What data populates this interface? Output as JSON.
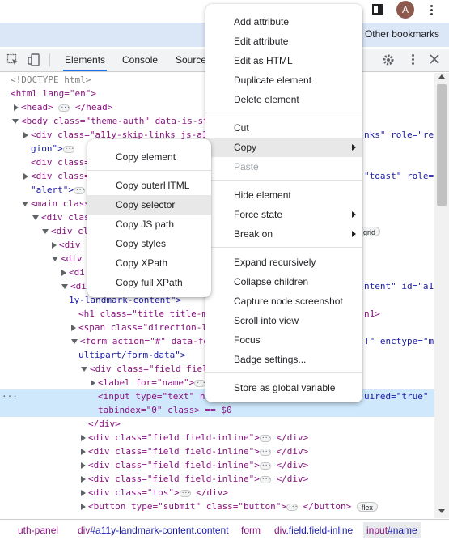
{
  "browser": {
    "bookmarks_label": "Other bookmarks",
    "avatar_letter": "A",
    "accent": "#dbe6f6"
  },
  "devtools": {
    "tabs": [
      "Elements",
      "Console",
      "Source"
    ],
    "active_tab": "Elements"
  },
  "dom_lines": [
    {
      "text": "<!DOCTYPE html>"
    },
    {
      "text": "<html lang=\"en\">"
    },
    {
      "text": "<head>"
    },
    {
      "text": "<body class=\"theme-auth\" data-is-st"
    },
    {
      "text": "<div class=\"a11y-skip-links js-a1"
    },
    {
      "text": "gion\">"
    },
    {
      "text": "<div class="
    },
    {
      "text": "<div class="
    },
    {
      "text": "\"alert\">"
    },
    {
      "text": "<main class"
    },
    {
      "text": "<div clas"
    },
    {
      "text": "<div cl"
    },
    {
      "text": "<div"
    },
    {
      "text": "<div"
    },
    {
      "text": "<di"
    },
    {
      "text": "<di"
    },
    {
      "text": "1y-landmark-content\">"
    },
    {
      "text": "<h1 class=\"title title-m"
    },
    {
      "text": "<span class=\"direction-l"
    },
    {
      "text": "<form action=\"#\" data-fo"
    },
    {
      "text": "ultipart/form-data\">"
    },
    {
      "text": "<div class=\"field fiel"
    },
    {
      "text": "<label for=\"name\">"
    },
    {
      "text": "<input type=\"text\" n"
    },
    {
      "text": "tabindex=\"0\" class> == $0"
    },
    {
      "text": "</div>"
    },
    {
      "text": "<div class=\"field field-inline\">"
    },
    {
      "text": "<div class=\"field field-inline\">"
    },
    {
      "text": "<div class=\"field field-inline\">"
    },
    {
      "text": "<div class=\"field field-inline\">"
    },
    {
      "text": "<div class=\"tos\">"
    },
    {
      "text": "<button type=\"submit\" class=\"button\">"
    }
  ],
  "dom_tails": {
    "l3": "</head>",
    "l4": "nks\" role=\"re",
    "l7": "\"toast\" role=",
    "l12": "grid",
    "l15": "ntent\" id=\"a1",
    "l17": "n1>",
    "l19": "T\" enctype=\"m",
    "l23": "uired=\"true\"",
    "closing_div": "</div>",
    "closing_button": "</button>",
    "flex_badge": "flex"
  },
  "breadcrumb": [
    {
      "t": "uth-panel",
      "c": ""
    },
    {
      "t": "div",
      "c": "#a11y-landmark-content.content"
    },
    {
      "t": "form",
      "c": ""
    },
    {
      "t": "div",
      "c": ".field.field-inline"
    },
    {
      "t": "input",
      "c": "#name"
    }
  ],
  "main_menu": {
    "items": [
      "Add attribute",
      "Edit attribute",
      "Edit as HTML",
      "Duplicate element",
      "Delete element",
      "Cut",
      "Copy",
      "Paste",
      "Hide element",
      "Force state",
      "Break on",
      "Expand recursively",
      "Collapse children",
      "Capture node screenshot",
      "Scroll into view",
      "Focus",
      "Badge settings...",
      "Store as global variable"
    ]
  },
  "copy_menu": {
    "items": [
      "Copy element",
      "Copy outerHTML",
      "Copy selector",
      "Copy JS path",
      "Copy styles",
      "Copy XPath",
      "Copy full XPath"
    ],
    "hovered": "Copy selector"
  }
}
